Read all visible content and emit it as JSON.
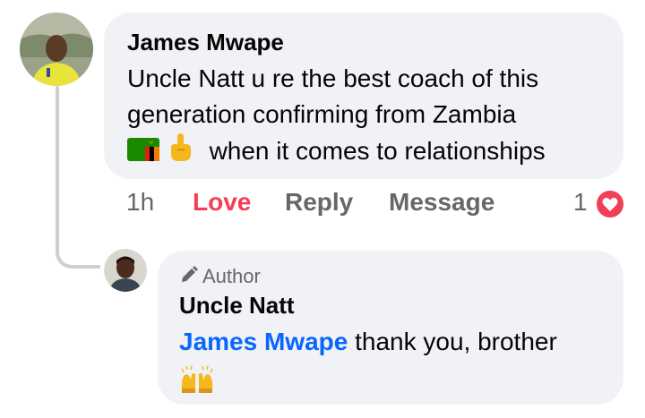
{
  "comment": {
    "author": "James Mwape",
    "text_line1": "Uncle Natt u re the best coach of this",
    "text_line2": "generation confirming from Zambia",
    "text_line3": "when it comes to relationships",
    "emojis": [
      "zambia-flag-icon",
      "index-pointing-up-icon"
    ],
    "time": "1h",
    "actions": {
      "love": "Love",
      "reply": "Reply",
      "message": "Message"
    },
    "reaction_count": "1",
    "love_color": "#f33e58"
  },
  "reply": {
    "badge": "Author",
    "author": "Uncle Natt",
    "mention": "James Mwape",
    "text": " thank you, brother",
    "emoji": "raising-hands-icon",
    "mention_color": "#0866ff"
  }
}
